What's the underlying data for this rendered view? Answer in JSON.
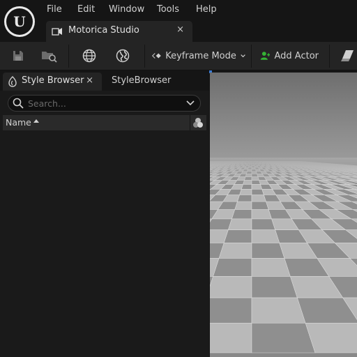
{
  "menu": {
    "items": [
      {
        "label": "File"
      },
      {
        "label": "Edit"
      },
      {
        "label": "Window"
      },
      {
        "label": "Tools"
      },
      {
        "label": "Help"
      }
    ]
  },
  "document_tab": {
    "label": "Motorica Studio",
    "close": "×"
  },
  "toolbar": {
    "mode_label": "Keyframe Mode",
    "add_actor_label": "Add Actor"
  },
  "panel": {
    "tabs": [
      {
        "label": "Style Browser",
        "close": "×",
        "active": true
      },
      {
        "label": "StyleBrowser",
        "active": false
      }
    ],
    "search": {
      "placeholder": "Search...",
      "value": ""
    },
    "columns": [
      {
        "label": "Name",
        "sort": "ascending"
      }
    ]
  },
  "colors": {
    "accent_green": "#35b335",
    "selection_blue": "#3a7bd5"
  }
}
